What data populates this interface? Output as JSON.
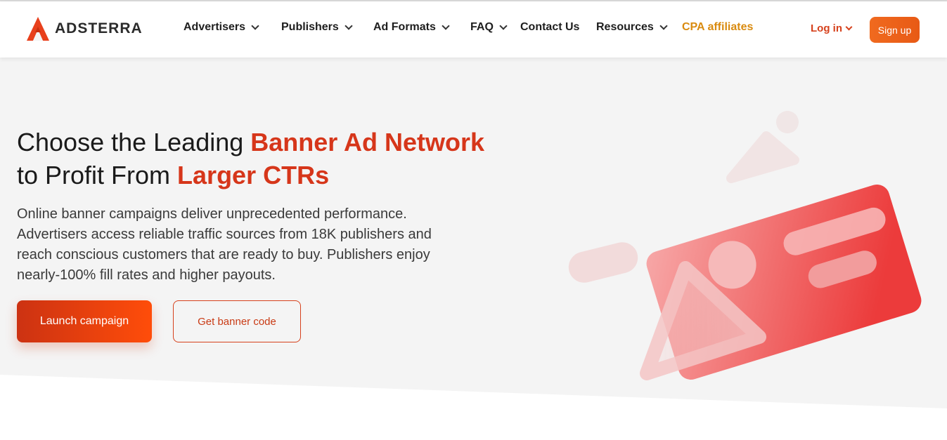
{
  "brand": {
    "name": "ADSTERRA",
    "accent": "#d6361a",
    "logo_icon": "adsterra-logo-icon"
  },
  "nav": {
    "items": [
      {
        "label": "Advertisers",
        "has_dropdown": true
      },
      {
        "label": "Publishers",
        "has_dropdown": true
      },
      {
        "label": "Ad Formats",
        "has_dropdown": true
      },
      {
        "label": "FAQ",
        "has_dropdown": true
      },
      {
        "label": "Contact Us",
        "has_dropdown": false
      },
      {
        "label": "Resources",
        "has_dropdown": true
      },
      {
        "label": "CPA affiliates",
        "has_dropdown": false
      }
    ],
    "login_label": "Log in",
    "signup_label": "Sign up"
  },
  "hero": {
    "title_part1": "Choose the Leading ",
    "title_accent1": "Banner Ad Network",
    "title_part2": "to Profit From ",
    "title_accent2": "Larger CTRs",
    "description": "Online banner campaigns deliver unprecedented performance. Advertisers access reliable traffic sources from 18K publishers and reach conscious customers that are ready to buy. Publishers enjoy nearly-100% fill rates and higher payouts.",
    "primary_button": "Launch campaign",
    "secondary_button": "Get banner code",
    "illustration": "banner-ad-illustration"
  },
  "colors": {
    "cpa": "#d98b10",
    "login": "#d6411c",
    "signup": "#f06a1f"
  }
}
